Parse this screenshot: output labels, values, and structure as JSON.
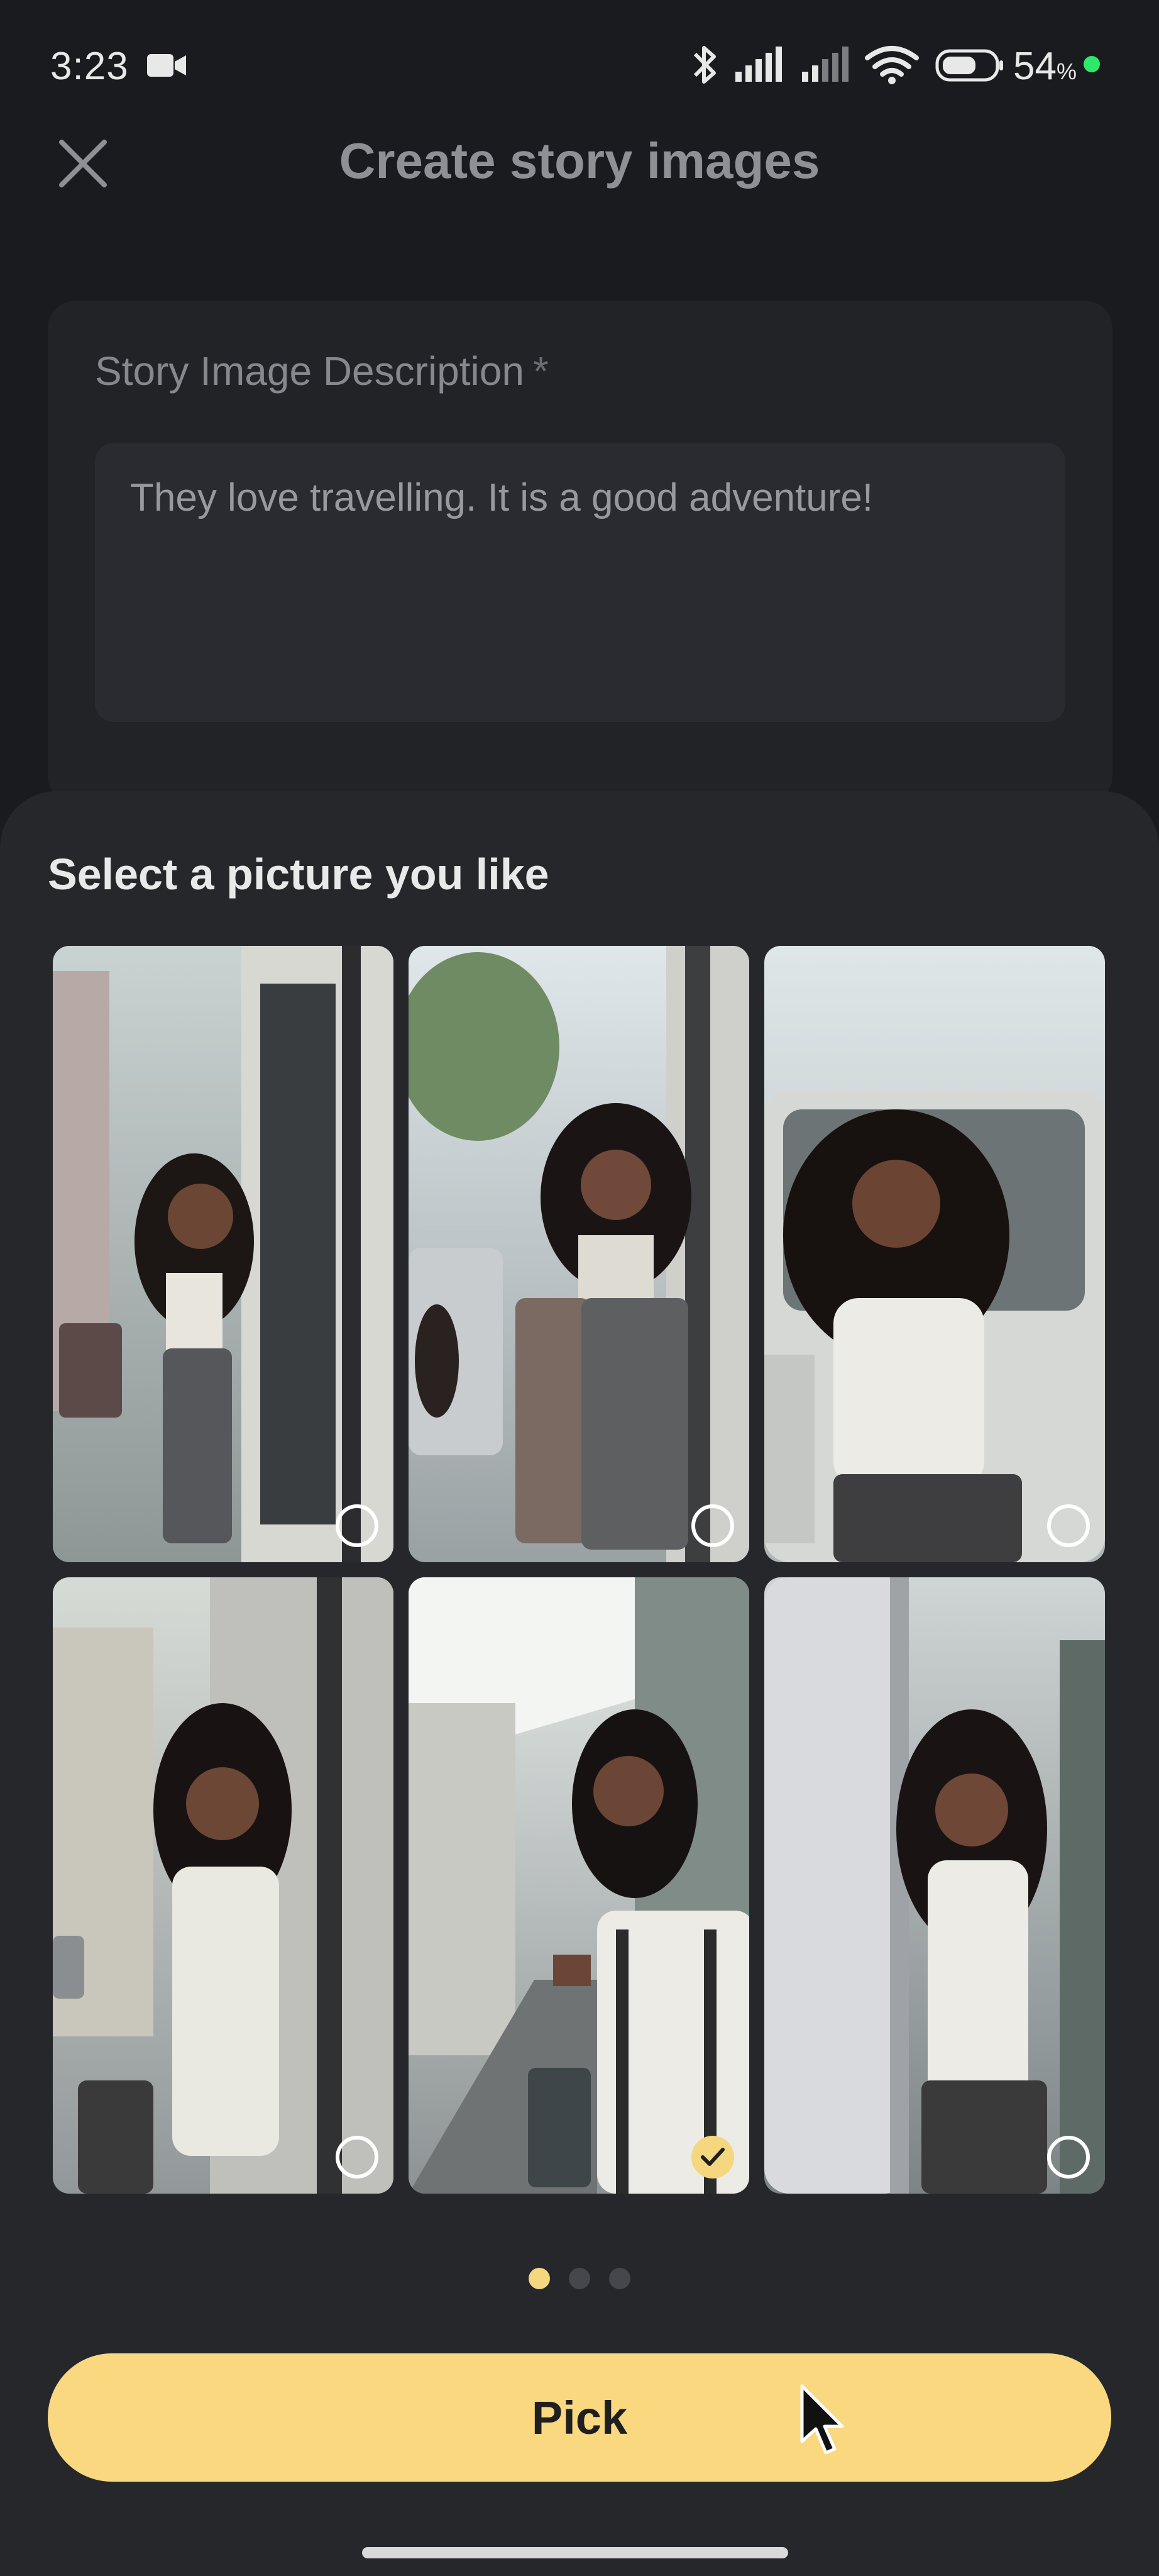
{
  "status_bar": {
    "time": "3:23",
    "battery_percent": "54",
    "battery_unit": "%",
    "battery_level": 0.54,
    "icons": [
      "video-camera-icon",
      "bluetooth-icon",
      "signal-icon",
      "signal-icon",
      "wifi-icon",
      "battery-icon",
      "charging-dot"
    ],
    "dot_color": "#2ee86a"
  },
  "header": {
    "title": "Create story images",
    "close_icon": "close-icon"
  },
  "form": {
    "label": "Story Image Description",
    "required_mark": "*",
    "description_value": "They love travelling. It is a good adventure!"
  },
  "picker": {
    "title": "Select a picture you like",
    "images": [
      {
        "description": "girl with suitcase beside bus door",
        "selected": false
      },
      {
        "description": "girl leaning on suitcase at doorway",
        "selected": false
      },
      {
        "description": "girl sitting on suitcase near van",
        "selected": false
      },
      {
        "description": "girl standing at bus door",
        "selected": false
      },
      {
        "description": "girl with white suitcase pointing up",
        "selected": true
      },
      {
        "description": "girl peeking from behind door",
        "selected": false
      }
    ],
    "page_count": 3,
    "current_page": 1,
    "pick_label": "Pick"
  },
  "colors": {
    "accent": "#fad87f",
    "background": "#1a1b1e",
    "sheet": "#26272b"
  }
}
